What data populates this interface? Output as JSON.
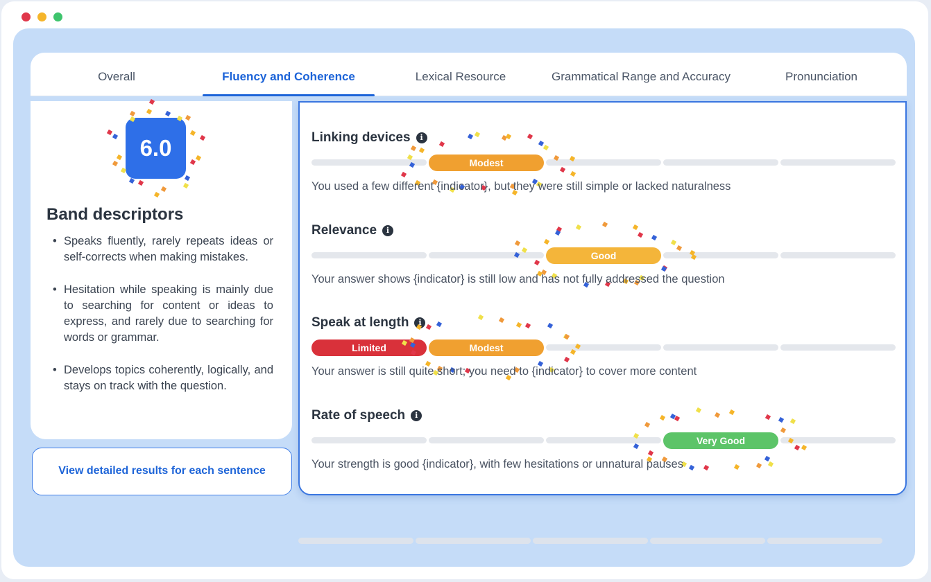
{
  "tabs": [
    {
      "label": "Overall"
    },
    {
      "label": "Fluency and Coherence",
      "active": true
    },
    {
      "label": "Lexical Resource"
    },
    {
      "label": "Grammatical Range and Accuracy"
    },
    {
      "label": "Pronunciation"
    }
  ],
  "score": "6.0",
  "band_descriptors": {
    "title": "Band descriptors",
    "items": [
      "Speaks fluently, rarely repeats ideas or self-corrects when making mistakes.",
      "Hesitation while speaking is mainly due to searching for content or ideas to express, and rarely due to searching for words or grammar.",
      "Develops topics coherently, logically, and stays on track with the question."
    ]
  },
  "detail_button": "View detailed results for each sentence",
  "scale_levels": 5,
  "criteria": [
    {
      "title": "Linking devices",
      "level": 2,
      "label": "Modest",
      "color": "#f0a030",
      "description": "You used a few different {indicator}, but they were still simple or lacked naturalness"
    },
    {
      "title": "Relevance",
      "level": 3,
      "label": "Good",
      "color": "#f4b53a",
      "description": "Your answer shows {indicator} is still low and has not fully addressed the question"
    },
    {
      "title": "Speak at length",
      "level": 2,
      "label": "Modest",
      "color": "#f0a030",
      "extra": {
        "label": "Limited",
        "color": "#d9313a"
      },
      "description": "Your answer is still quite short; you need to {indicator} to cover more content"
    },
    {
      "title": "Rate of speech",
      "level": 4,
      "label": "Very Good",
      "color": "#5cc468",
      "description": "Your strength is good {indicator}, with few hesitations or unnatural pauses"
    }
  ],
  "info_icon": "info-icon",
  "confetti_colors": [
    "#f5b52a",
    "#e0374a",
    "#3562d8",
    "#f0e04a",
    "#f09a3c"
  ]
}
